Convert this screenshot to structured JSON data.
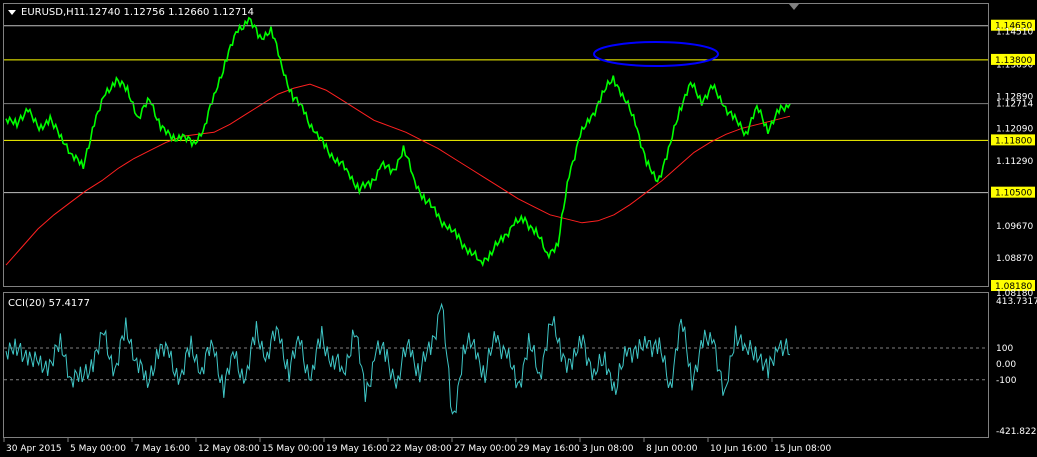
{
  "header": {
    "symbol": "EURUSD,H1",
    "ohlc": "1.12740 1.12756 1.12660 1.12714"
  },
  "cci_header": "CCI(20) 57.4177",
  "chart_data": [
    {
      "type": "line",
      "title": "EURUSD,H1",
      "ylim": [
        1.0818,
        1.1519
      ],
      "y_ticks": [
        "1.13690",
        "1.12890",
        "1.12090",
        "1.11290",
        "1.09670",
        "1.08870"
      ],
      "top_tick": "1.14510",
      "bottom_tick": "1.08180",
      "current_price": "1.12714",
      "horizontal_levels": [
        {
          "value": 1.1465,
          "label": "1.14650",
          "color": "#ffff00",
          "style": "white"
        },
        {
          "value": 1.138,
          "label": "1.13800",
          "color": "#ffff00",
          "style": "yellow"
        },
        {
          "value": 1.118,
          "label": "1.11800",
          "color": "#ffff00",
          "style": "yellow"
        },
        {
          "value": 1.105,
          "label": "1.10500",
          "color": "#ffff00",
          "style": "white"
        },
        {
          "value": 1.0818,
          "label": "1.08180",
          "color": "#ffff00",
          "style": "none"
        }
      ],
      "x_ticks": [
        "30 Apr 2015",
        "5 May 00:00",
        "7 May 16:00",
        "12 May 08:00",
        "15 May 00:00",
        "19 May 16:00",
        "22 May 08:00",
        "27 May 00:00",
        "29 May 16:00",
        "3 Jun 08:00",
        "8 Jun 00:00",
        "10 Jun 16:00",
        "15 Jun 08:00"
      ],
      "series": [
        {
          "color": "#00ff00",
          "y": [
            1.124,
            1.1215,
            1.1265,
            1.12,
            1.124,
            1.118,
            1.115,
            1.111,
            1.123,
            1.129,
            1.1335,
            1.13,
            1.124,
            1.128,
            1.122,
            1.118,
            1.1195,
            1.1165,
            1.122,
            1.13,
            1.139,
            1.145,
            1.1485,
            1.143,
            1.146,
            1.136,
            1.129,
            1.125,
            1.12,
            1.116,
            1.113,
            1.11,
            1.106,
            1.107,
            1.112,
            1.11,
            1.116,
            1.108,
            1.103,
            1.1,
            1.096,
            1.094,
            1.09,
            1.088,
            1.09,
            1.094,
            1.097,
            1.0985,
            1.095,
            1.09,
            1.092,
            1.11,
            1.119,
            1.124,
            1.129,
            1.134,
            1.128,
            1.123,
            1.112,
            1.108,
            1.115,
            1.126,
            1.132,
            1.128,
            1.131,
            1.127,
            1.123,
            1.12,
            1.126,
            1.121,
            1.125,
            1.1271
          ]
        },
        {
          "color": "#ff2020",
          "y": [
            1.087,
            1.0915,
            1.096,
            1.0995,
            1.1025,
            1.1055,
            1.108,
            1.111,
            1.1135,
            1.1155,
            1.1175,
            1.119,
            1.1195,
            1.12,
            1.122,
            1.1245,
            1.127,
            1.1295,
            1.131,
            1.132,
            1.1305,
            1.128,
            1.1255,
            1.123,
            1.1215,
            1.12,
            1.118,
            1.116,
            1.1135,
            1.111,
            1.1085,
            1.106,
            1.1035,
            1.1015,
            1.0995,
            1.0985,
            1.0975,
            1.098,
            1.0995,
            1.102,
            1.105,
            1.108,
            1.1115,
            1.115,
            1.1175,
            1.1195,
            1.121,
            1.122,
            1.123,
            1.124
          ]
        }
      ],
      "annotation": {
        "shape": "ellipse",
        "color": "#0000ff"
      }
    },
    {
      "type": "line",
      "title": "CCI(20) 57.4177",
      "ylim": [
        -421.8225,
        413.7317
      ],
      "y_ticks": [
        "413.7317",
        "100",
        "0.00",
        "-100",
        "-421.8225"
      ],
      "levels": [
        100,
        -100
      ],
      "series": [
        {
          "color": "#3fc6c6",
          "y": [
            120,
            60,
            80,
            -40,
            20,
            100,
            -60,
            -110,
            40,
            160,
            -30,
            200,
            50,
            -150,
            120,
            30,
            -80,
            90,
            -20,
            110,
            -130,
            40,
            -90,
            190,
            60,
            210,
            -40,
            140,
            -100,
            170,
            20,
            -60,
            230,
            -200,
            90,
            40,
            -120,
            150,
            -70,
            110,
            380,
            -350,
            60,
            150,
            -90,
            200,
            40,
            -140,
            120,
            -60,
            260,
            90,
            -30,
            180,
            -110,
            70,
            -200,
            130,
            40,
            160,
            80,
            -120,
            260,
            -80,
            110,
            180,
            -250,
            230,
            60,
            100,
            -80,
            150,
            57
          ]
        }
      ]
    }
  ]
}
